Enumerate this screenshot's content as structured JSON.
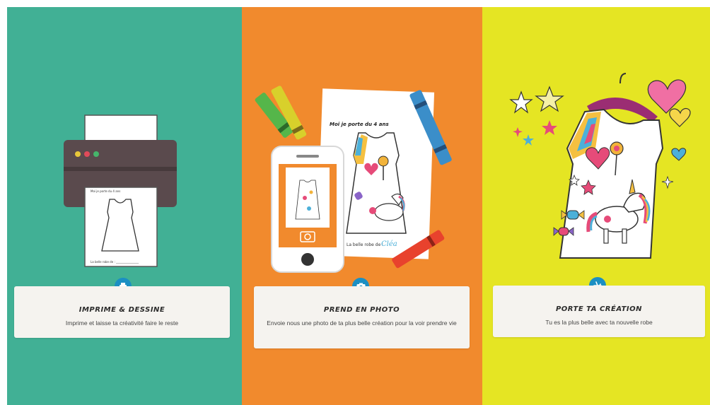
{
  "steps": [
    {
      "title": "IMPRIME & DESSINE",
      "description": "Imprime et laisse ta créativité faire le reste",
      "icon": "printer-icon",
      "sheet_title": "Moi je porte du 4 ans",
      "sheet_footer": "La belle robe de : ________________"
    },
    {
      "title": "PREND EN PHOTO",
      "description": "Envoie nous une photo de ta plus belle création pour la voir prendre vie",
      "icon": "camera-icon",
      "sheet_title": "Moi je porte du 4 ans",
      "sheet_footer": "La belle robe de :",
      "sheet_name": "Cléa"
    },
    {
      "title": "PORTE TA CRÉATION",
      "description": "Tu es la plus belle avec ta nouvelle robe",
      "icon": "plane-icon"
    }
  ],
  "colors": {
    "panel_1": "#41b095",
    "panel_2": "#f18a2d",
    "panel_3": "#e5e523",
    "badge": "#1b8fc3"
  }
}
